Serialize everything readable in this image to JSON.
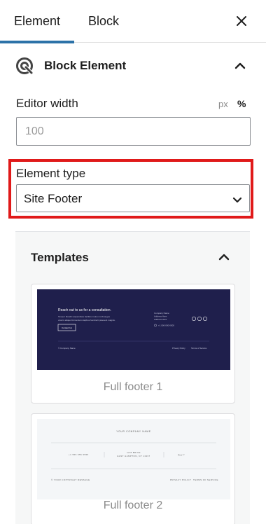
{
  "tabs": {
    "element": "Element",
    "block": "Block"
  },
  "panel": {
    "title": "Block Element"
  },
  "editor_width": {
    "label": "Editor width",
    "unit_px": "px",
    "unit_pct": "%",
    "placeholder": "100"
  },
  "element_type": {
    "label": "Element type",
    "selected": "Site Footer"
  },
  "templates": {
    "title": "Templates",
    "items": [
      {
        "caption": "Full footer 1",
        "thumb": {
          "heading": "Reach out to us for a consultation.",
          "body_line1": "Tempor blandit suspendisse facilisis metus morbi augue",
          "body_line2": "viverra aliquet fermentum dapibus hendrerit praesent magnis.",
          "button": "Contact Us",
          "company_lines": [
            "Company Name",
            "Address Here",
            "Address Here"
          ],
          "phone": "+1 000-000-0000",
          "copyright": "© Company Name",
          "links": [
            "Privacy Policy",
            "Terms of Service"
          ]
        }
      },
      {
        "caption": "Full footer 2",
        "thumb": {
          "heading": "YOUR COMPANY NAME",
          "phone": "+1 555 555 5555",
          "address_line1": "12/8 BRICE",
          "address_line2": "EAST HAMPTON, NY 11937",
          "copyright": "© YOUR COPYRIGHT MESSAGE",
          "links": [
            "PRIVACY POLICY",
            "TERMS OF SERVICE"
          ]
        }
      }
    ]
  },
  "colors": {
    "accent": "#2c72a8",
    "highlight": "#e01a1a",
    "footer1_bg": "#1f1f4c"
  }
}
